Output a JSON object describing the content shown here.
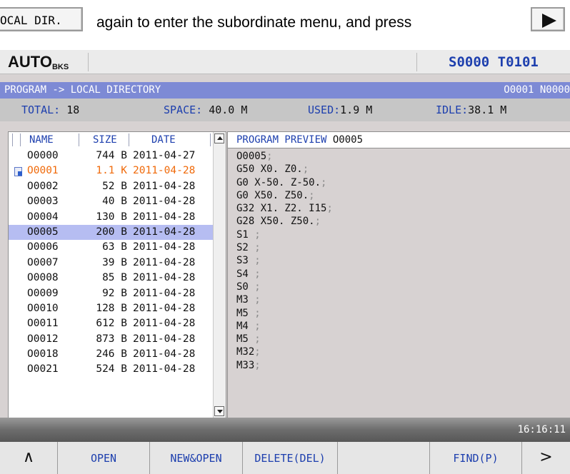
{
  "manual": {
    "key_label": "OCAL DIR.",
    "instruction": "again to enter the subordinate menu, and press",
    "play_key": "play-key"
  },
  "status": {
    "mode_main": "AUTO",
    "mode_sub": "BKS",
    "spindle_tool": "S0000 T0101"
  },
  "title": {
    "path": "PROGRAM -> LOCAL DIRECTORY",
    "program": "O0001 N0000"
  },
  "summary": {
    "total_label": "TOTAL:",
    "total_value": "18",
    "space_label": "SPACE:",
    "space_value": "40.0 M",
    "used_label": "USED:",
    "used_value": "1.9 M",
    "idle_label": "IDLE:",
    "idle_value": "38.1 M"
  },
  "file_list": {
    "headers": {
      "name": "NAME",
      "size": "SIZE",
      "date": "DATE"
    },
    "rows": [
      {
        "name": "O0000",
        "size": "744 B",
        "date": "2011-04-27"
      },
      {
        "name": "O0001",
        "size": "1.1 K",
        "date": "2011-04-28"
      },
      {
        "name": "O0002",
        "size": "52 B",
        "date": "2011-04-28"
      },
      {
        "name": "O0003",
        "size": "40 B",
        "date": "2011-04-28"
      },
      {
        "name": "O0004",
        "size": "130 B",
        "date": "2011-04-28"
      },
      {
        "name": "O0005",
        "size": "200 B",
        "date": "2011-04-28"
      },
      {
        "name": "O0006",
        "size": "63 B",
        "date": "2011-04-28"
      },
      {
        "name": "O0007",
        "size": "39 B",
        "date": "2011-04-28"
      },
      {
        "name": "O0008",
        "size": "85 B",
        "date": "2011-04-28"
      },
      {
        "name": "O0009",
        "size": "92 B",
        "date": "2011-04-28"
      },
      {
        "name": "O0010",
        "size": "128 B",
        "date": "2011-04-28"
      },
      {
        "name": "O0011",
        "size": "612 B",
        "date": "2011-04-28"
      },
      {
        "name": "O0012",
        "size": "873 B",
        "date": "2011-04-28"
      },
      {
        "name": "O0018",
        "size": "246 B",
        "date": "2011-04-28"
      },
      {
        "name": "O0021",
        "size": "524 B",
        "date": "2011-04-28"
      }
    ]
  },
  "preview": {
    "title": "PROGRAM PREVIEW",
    "program": "O0005",
    "lines": [
      "O0005",
      "G50 X0. Z0.",
      "G0 X-50. Z-50.",
      "G0 X50. Z50.",
      "G32 X1. Z2. I15",
      "G28 X50. Z50.",
      "S1 ",
      "S2 ",
      "S3 ",
      "S4 ",
      "S0 ",
      "M3 ",
      "M5 ",
      "M4 ",
      "M5 ",
      "M32",
      "M33"
    ]
  },
  "clock": "16:16:11",
  "softkeys": {
    "left_arrow": "∧",
    "open": "OPEN",
    "new_open": "NEW&OPEN",
    "delete": "DELETE(DEL)",
    "find": "FIND(P)",
    "right_arrow": ">"
  },
  "colors": {
    "title_bar": "#7d8ad5",
    "highlight_blue": "#1d3fae",
    "current_orange": "#f06a0a",
    "selected_row": "#b6bdf2"
  }
}
